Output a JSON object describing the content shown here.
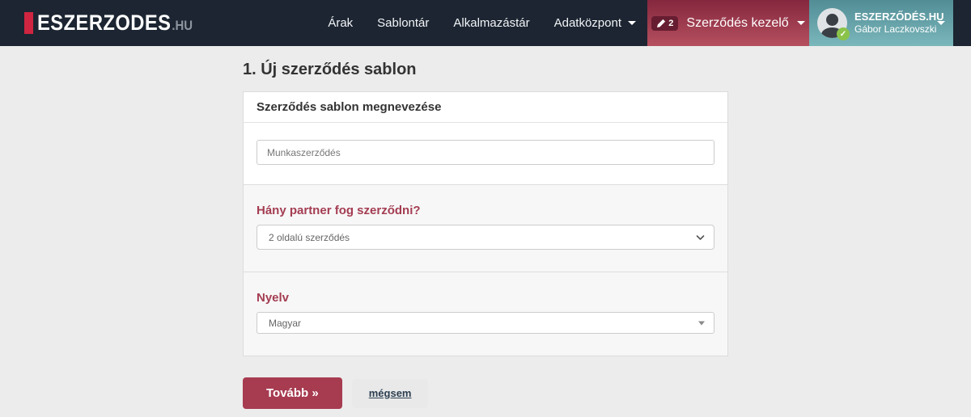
{
  "navbar": {
    "logo": {
      "text": "ESZERZODES",
      "tld": ".HU"
    },
    "links": [
      {
        "label": "Árak"
      },
      {
        "label": "Sablontár"
      },
      {
        "label": "Alkalmazástár"
      },
      {
        "label": "Adatközpont"
      }
    ],
    "contract_manager": {
      "label": "Szerződés kezelő",
      "badge_count": "2"
    },
    "user": {
      "org": "ESZERZŐDÉS.HU",
      "name": "Gábor Laczkovszki",
      "badge_check": "✓"
    }
  },
  "page": {
    "title": "1. Új szerződés sablon"
  },
  "form": {
    "card_header": "Szerződés sablon megnevezése",
    "template_name": {
      "value": "Munkaszerződés"
    },
    "partner_question": {
      "label": "Hány partner fog szerződni?",
      "selected": "2 oldalú szerződés"
    },
    "language": {
      "label": "Nyelv",
      "selected": "Magyar"
    }
  },
  "actions": {
    "next": "Tovább »",
    "cancel": "mégsem"
  },
  "colors": {
    "navbar_bg": "#1c2531",
    "logo_red": "#cf2540",
    "contract_manager_gradient_top": "#85273e",
    "contract_manager_gradient_bottom": "#b5505f",
    "user_gradient_top": "#528d96",
    "user_gradient_bottom": "#7ab7bb",
    "accent_maroon": "#a43d52",
    "page_bg": "#ececec",
    "section_bg": "#f7f7f7",
    "avatar_badge_green": "#8bc34a"
  }
}
